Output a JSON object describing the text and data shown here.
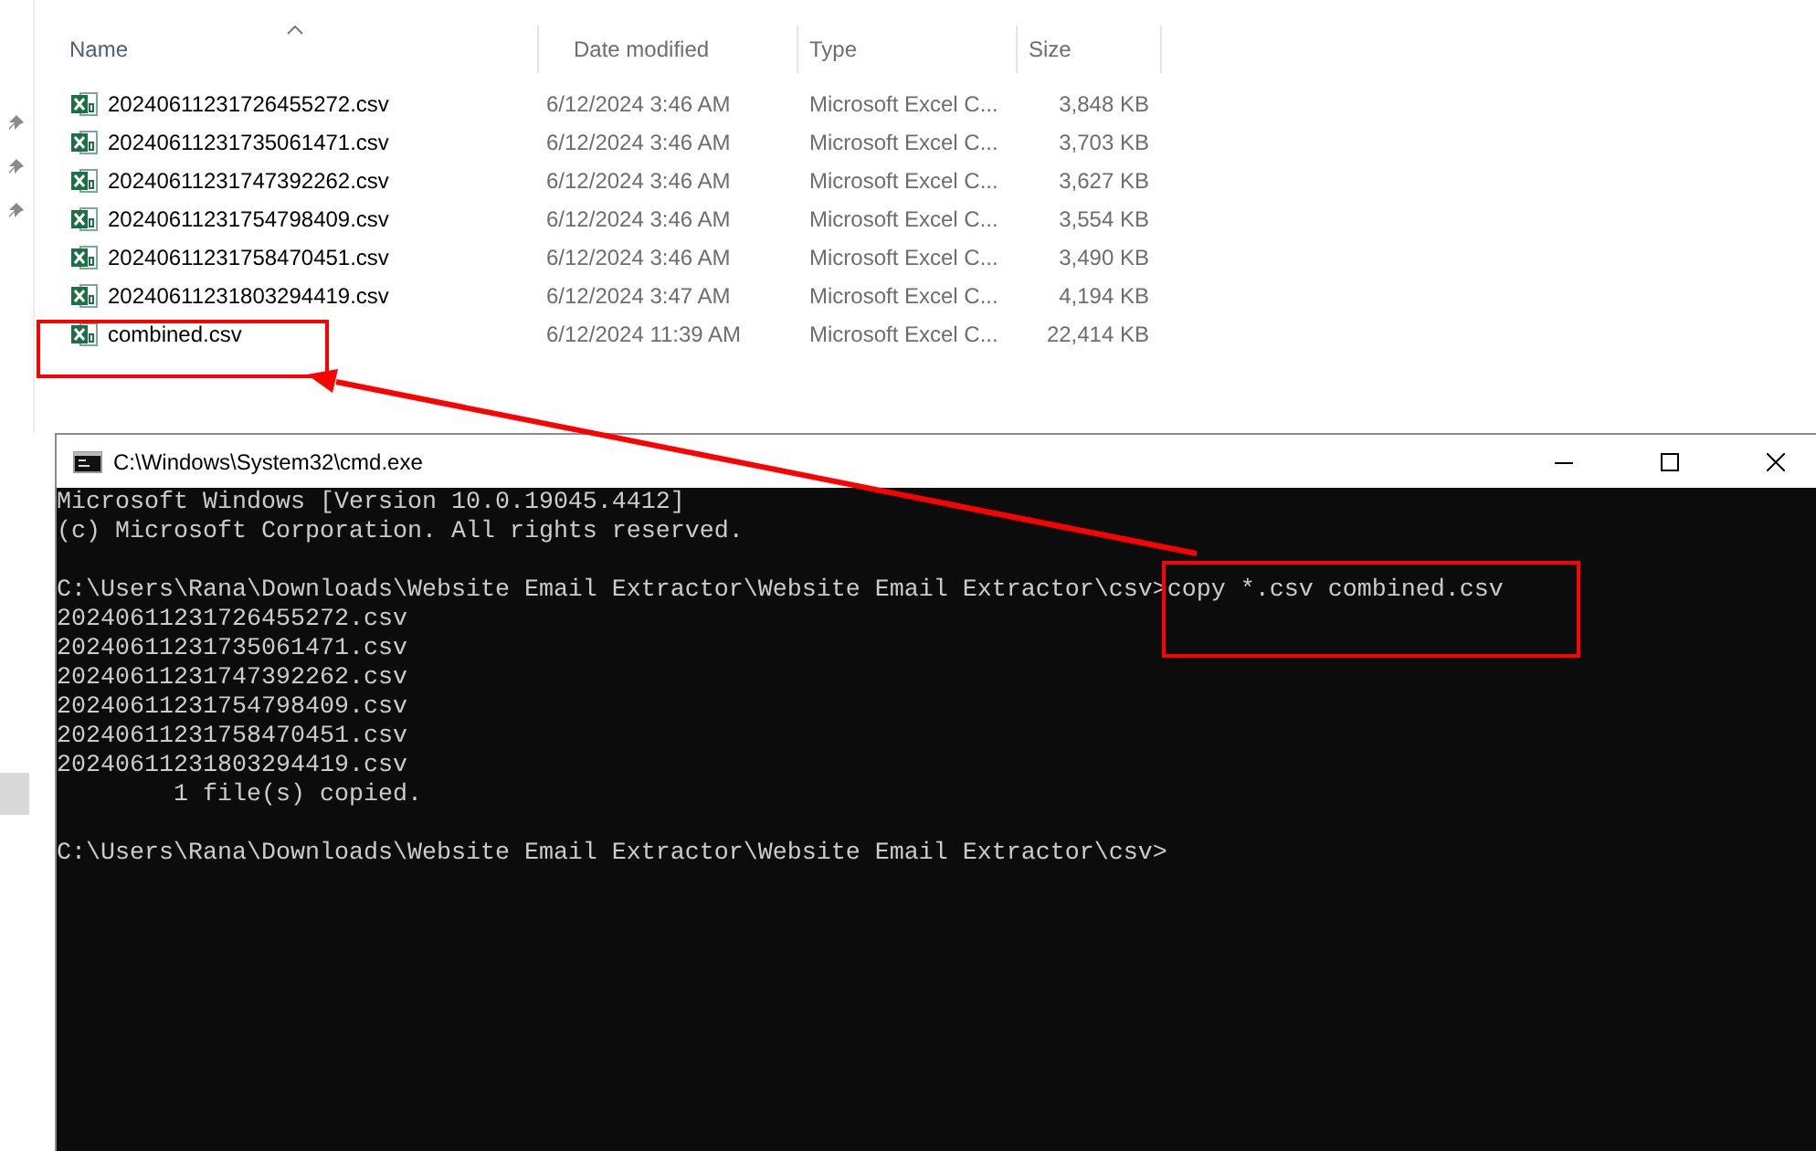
{
  "explorer": {
    "columns": [
      {
        "label": "Name",
        "sorted": true
      },
      {
        "label": "Date modified",
        "sorted": false
      },
      {
        "label": "Type",
        "sorted": false
      },
      {
        "label": "Size",
        "sorted": false
      }
    ],
    "files": [
      {
        "name": "20240611231726455272.csv",
        "date": "6/12/2024 3:46 AM",
        "type": "Microsoft Excel C...",
        "size": "3,848 KB",
        "highlighted": false
      },
      {
        "name": "20240611231735061471.csv",
        "date": "6/12/2024 3:46 AM",
        "type": "Microsoft Excel C...",
        "size": "3,703 KB",
        "highlighted": false
      },
      {
        "name": "20240611231747392262.csv",
        "date": "6/12/2024 3:46 AM",
        "type": "Microsoft Excel C...",
        "size": "3,627 KB",
        "highlighted": false
      },
      {
        "name": "20240611231754798409.csv",
        "date": "6/12/2024 3:46 AM",
        "type": "Microsoft Excel C...",
        "size": "3,554 KB",
        "highlighted": false
      },
      {
        "name": "20240611231758470451.csv",
        "date": "6/12/2024 3:46 AM",
        "type": "Microsoft Excel C...",
        "size": "3,490 KB",
        "highlighted": false
      },
      {
        "name": "20240611231803294419.csv",
        "date": "6/12/2024 3:47 AM",
        "type": "Microsoft Excel C...",
        "size": "4,194 KB",
        "highlighted": false
      },
      {
        "name": "combined.csv",
        "date": "6/12/2024 11:39 AM",
        "type": "Microsoft Excel C...",
        "size": "22,414 KB",
        "highlighted": true
      }
    ]
  },
  "console": {
    "title": "C:\\Windows\\System32\\cmd.exe",
    "lines": [
      {
        "kind": "text",
        "text": "Microsoft Windows [Version 10.0.19045.4412]"
      },
      {
        "kind": "text",
        "text": "(c) Microsoft Corporation. All rights reserved."
      },
      {
        "kind": "blank"
      },
      {
        "kind": "prompt",
        "text": "C:\\Users\\Rana\\Downloads\\Website Email Extractor\\Website Email Extractor\\csv>",
        "command": "copy *.csv combined.csv",
        "highlighted": true
      },
      {
        "kind": "text",
        "text": "20240611231726455272.csv"
      },
      {
        "kind": "text",
        "text": "20240611231735061471.csv"
      },
      {
        "kind": "text",
        "text": "20240611231747392262.csv"
      },
      {
        "kind": "text",
        "text": "20240611231754798409.csv"
      },
      {
        "kind": "text",
        "text": "20240611231758470451.csv"
      },
      {
        "kind": "text",
        "text": "20240611231803294419.csv"
      },
      {
        "kind": "text",
        "text": "        1 file(s) copied."
      },
      {
        "kind": "blank"
      },
      {
        "kind": "prompt",
        "text": "C:\\Users\\Rana\\Downloads\\Website Email Extractor\\Website Email Extractor\\csv>"
      }
    ]
  }
}
